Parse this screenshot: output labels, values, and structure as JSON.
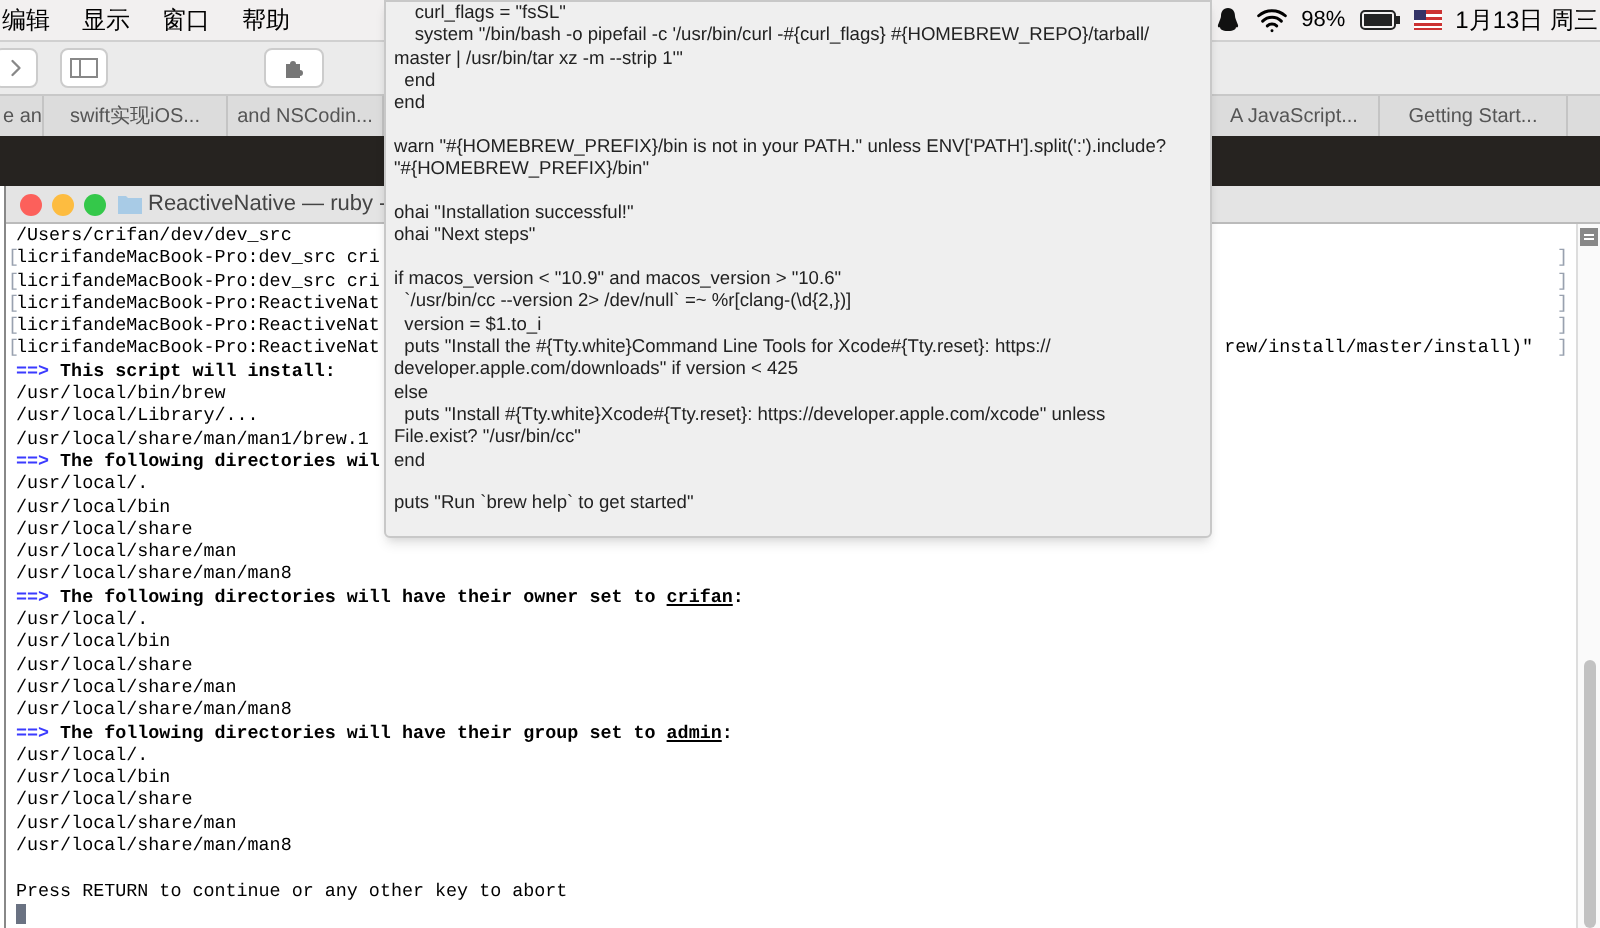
{
  "menu_bar": {
    "items": [
      "编辑",
      "显示",
      "窗口",
      "帮助"
    ],
    "battery": "98%",
    "clock": "1月13日 周三"
  },
  "browser": {
    "tabs": [
      {
        "label": "e an",
        "selected": false
      },
      {
        "label": "swift实现iOS...",
        "selected": false
      },
      {
        "label": "and NSCodin...",
        "selected": false
      },
      {
        "label": "A JavaScript...",
        "selected": false
      },
      {
        "label": "Getting Start...",
        "selected": false
      }
    ]
  },
  "terminal": {
    "title": "ReactiveNative — ruby -",
    "lines": [
      {
        "kind": "plain",
        "text": "/Users/crifan/dev/dev_src"
      },
      {
        "kind": "plain",
        "mark": "[",
        "text": "licrifandeMacBook-Pro:dev_src cri",
        "end_mark": "]"
      },
      {
        "kind": "plain",
        "mark": "[",
        "text": "licrifandeMacBook-Pro:dev_src cri",
        "end_mark": "]"
      },
      {
        "kind": "plain",
        "mark": "[",
        "text": "licrifandeMacBook-Pro:ReactiveNat",
        "end_mark": "]"
      },
      {
        "kind": "plain",
        "mark": "[",
        "text": "licrifandeMacBook-Pro:ReactiveNat",
        "end_mark": "]"
      },
      {
        "kind": "plain",
        "mark": "[",
        "text": "licrifandeMacBook-Pro:ReactiveNat",
        "tail": "rew/install/master/install)\"",
        "end_mark": "]"
      },
      {
        "kind": "heading",
        "arrow": "==>",
        "text": "This script will install:"
      },
      {
        "kind": "plain",
        "text": "/usr/local/bin/brew"
      },
      {
        "kind": "plain",
        "text": "/usr/local/Library/..."
      },
      {
        "kind": "plain",
        "text": "/usr/local/share/man/man1/brew.1"
      },
      {
        "kind": "heading",
        "arrow": "==>",
        "text": "The following directories wil"
      },
      {
        "kind": "plain",
        "text": "/usr/local/."
      },
      {
        "kind": "plain",
        "text": "/usr/local/bin"
      },
      {
        "kind": "plain",
        "text": "/usr/local/share"
      },
      {
        "kind": "plain",
        "text": "/usr/local/share/man"
      },
      {
        "kind": "plain",
        "text": "/usr/local/share/man/man8"
      },
      {
        "kind": "heading",
        "arrow": "==>",
        "text": "The following directories will have their owner set to ",
        "underlined": "crifan",
        "suffix": ":"
      },
      {
        "kind": "plain",
        "text": "/usr/local/."
      },
      {
        "kind": "plain",
        "text": "/usr/local/bin"
      },
      {
        "kind": "plain",
        "text": "/usr/local/share"
      },
      {
        "kind": "plain",
        "text": "/usr/local/share/man"
      },
      {
        "kind": "plain",
        "text": "/usr/local/share/man/man8"
      },
      {
        "kind": "heading",
        "arrow": "==>",
        "text": "The following directories will have their group set to ",
        "underlined": "admin",
        "suffix": ":"
      },
      {
        "kind": "plain",
        "text": "/usr/local/."
      },
      {
        "kind": "plain",
        "text": "/usr/local/bin"
      },
      {
        "kind": "plain",
        "text": "/usr/local/share"
      },
      {
        "kind": "plain",
        "text": "/usr/local/share/man"
      },
      {
        "kind": "plain",
        "text": "/usr/local/share/man/man8"
      },
      {
        "kind": "blank"
      },
      {
        "kind": "plain",
        "text": "Press RETURN to continue or any other key to abort"
      },
      {
        "kind": "cursor"
      }
    ]
  },
  "popup": {
    "blocks": [
      [
        "    curl_flags = \"fsSL\"",
        "    system \"/bin/bash -o pipefail -c '/usr/bin/curl -#{curl_flags} #{HOMEBREW_REPO}/tarball/",
        "master | /usr/bin/tar xz -m --strip 1'\"",
        "  end",
        "end"
      ],
      [
        "warn \"#{HOMEBREW_PREFIX}/bin is not in your PATH.\" unless ENV['PATH'].split(':').include?",
        "\"#{HOMEBREW_PREFIX}/bin\""
      ],
      [
        "ohai \"Installation successful!\"",
        "ohai \"Next steps\""
      ],
      [
        "if macos_version < \"10.9\" and macos_version > \"10.6\"",
        "  `/usr/bin/cc --version 2> /dev/null` =~ %r[clang-(\\d{2,})]",
        "  version = $1.to_i",
        "  puts \"Install the #{Tty.white}Command Line Tools for Xcode#{Tty.reset}: https://",
        "developer.apple.com/downloads\" if version < 425",
        "else",
        "  puts \"Install #{Tty.white}Xcode#{Tty.reset}: https://developer.apple.com/xcode\" unless",
        "File.exist? \"/usr/bin/cc\"",
        "end"
      ],
      [
        "puts \"Run `brew help` to get started\""
      ]
    ]
  }
}
